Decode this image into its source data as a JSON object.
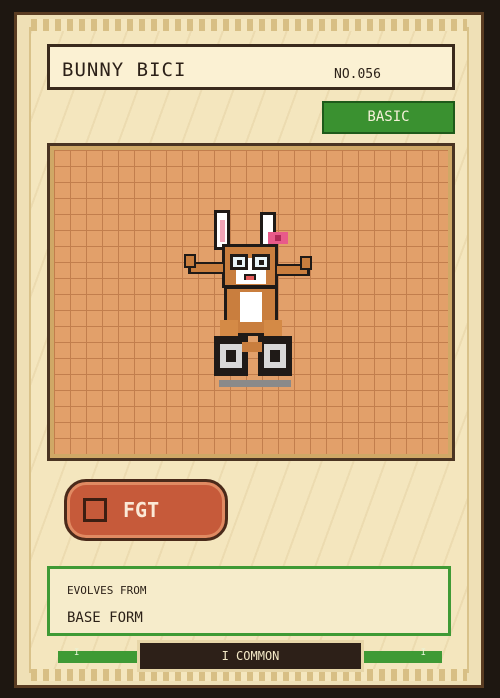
{
  "card": {
    "name": "BUNNY BICI",
    "number": "NO.056",
    "stage": "BASIC",
    "type_label": "FGT",
    "evolves_from_label": "EVOLVES FROM",
    "evolves_from_value": "BASE FORM",
    "rarity": "I COMMON",
    "footer_mark": "I"
  },
  "colors": {
    "stage_badge": "#3a9130",
    "type_pill": "#c65a3a",
    "art_background": "#e2a06a",
    "card_background": "#f4e6be"
  },
  "icons": {
    "sprite": "bunny-on-bike",
    "type_icon": "square-outline"
  }
}
